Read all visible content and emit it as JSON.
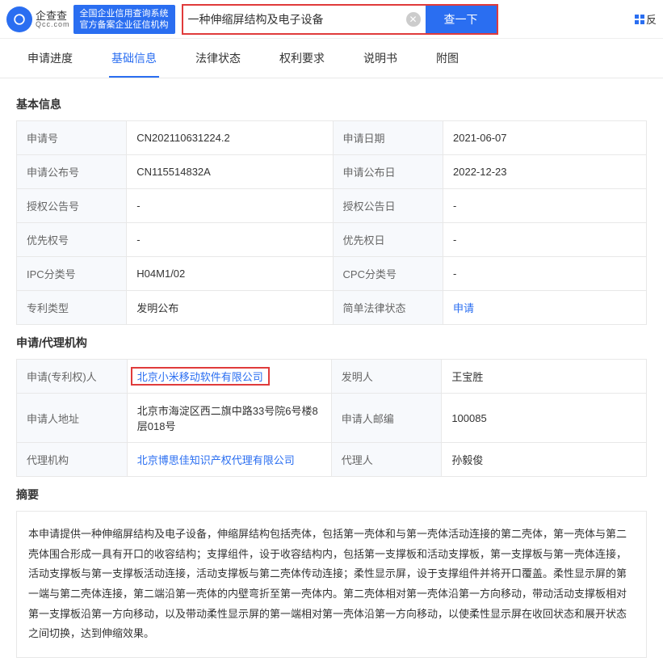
{
  "header": {
    "logo_cn": "企查查",
    "logo_en": "Qcc.com",
    "slogan_l1": "全国企业信用查询系统",
    "slogan_l2": "官方备案企业征信机构",
    "search_value": "一种伸缩屏结构及电子设备",
    "search_btn": "查一下",
    "right_txt": "反"
  },
  "tabs": {
    "t0": "申请进度",
    "t1": "基础信息",
    "t2": "法律状态",
    "t3": "权利要求",
    "t4": "说明书",
    "t5": "附图"
  },
  "sec_titles": {
    "basic": "基本信息",
    "agency": "申请/代理机构",
    "abstract": "摘要"
  },
  "basic": {
    "row0": {
      "l1": "申请号",
      "v1": "CN202110631224.2",
      "l2": "申请日期",
      "v2": "2021-06-07"
    },
    "row1": {
      "l1": "申请公布号",
      "v1": "CN115514832A",
      "l2": "申请公布日",
      "v2": "2022-12-23"
    },
    "row2": {
      "l1": "授权公告号",
      "v1": "-",
      "l2": "授权公告日",
      "v2": "-"
    },
    "row3": {
      "l1": "优先权号",
      "v1": "-",
      "l2": "优先权日",
      "v2": "-"
    },
    "row4": {
      "l1": "IPC分类号",
      "v1": "H04M1/02",
      "l2": "CPC分类号",
      "v2": "-"
    },
    "row5": {
      "l1": "专利类型",
      "v1": "发明公布",
      "l2": "简单法律状态",
      "v2": "申请"
    }
  },
  "agency": {
    "row0": {
      "l1": "申请(专利权)人",
      "v1": "北京小米移动软件有限公司",
      "l2": "发明人",
      "v2": "王宝胜"
    },
    "row1": {
      "l1": "申请人地址",
      "v1": "北京市海淀区西二旗中路33号院6号楼8层018号",
      "l2": "申请人邮编",
      "v2": "100085"
    },
    "row2": {
      "l1": "代理机构",
      "v1": "北京博思佳知识产权代理有限公司",
      "l2": "代理人",
      "v2": "孙毅俊"
    }
  },
  "abstract": "本申请提供一种伸缩屏结构及电子设备，伸缩屏结构包括壳体，包括第一壳体和与第一壳体活动连接的第二壳体，第一壳体与第二壳体围合形成一具有开口的收容结构；支撑组件，设于收容结构内，包括第一支撑板和活动支撑板，第一支撑板与第一壳体连接，活动支撑板与第一支撑板活动连接，活动支撑板与第二壳体传动连接；柔性显示屏，设于支撑组件并将开口覆盖。柔性显示屏的第一端与第二壳体连接，第二端沿第一壳体的内壁弯折至第一壳体内。第二壳体相对第一壳体沿第一方向移动，带动活动支撑板相对第一支撑板沿第一方向移动，以及带动柔性显示屏的第一端相对第一壳体沿第一方向移动，以使柔性显示屏在收回状态和展开状态之间切换，达到伸缩效果。"
}
